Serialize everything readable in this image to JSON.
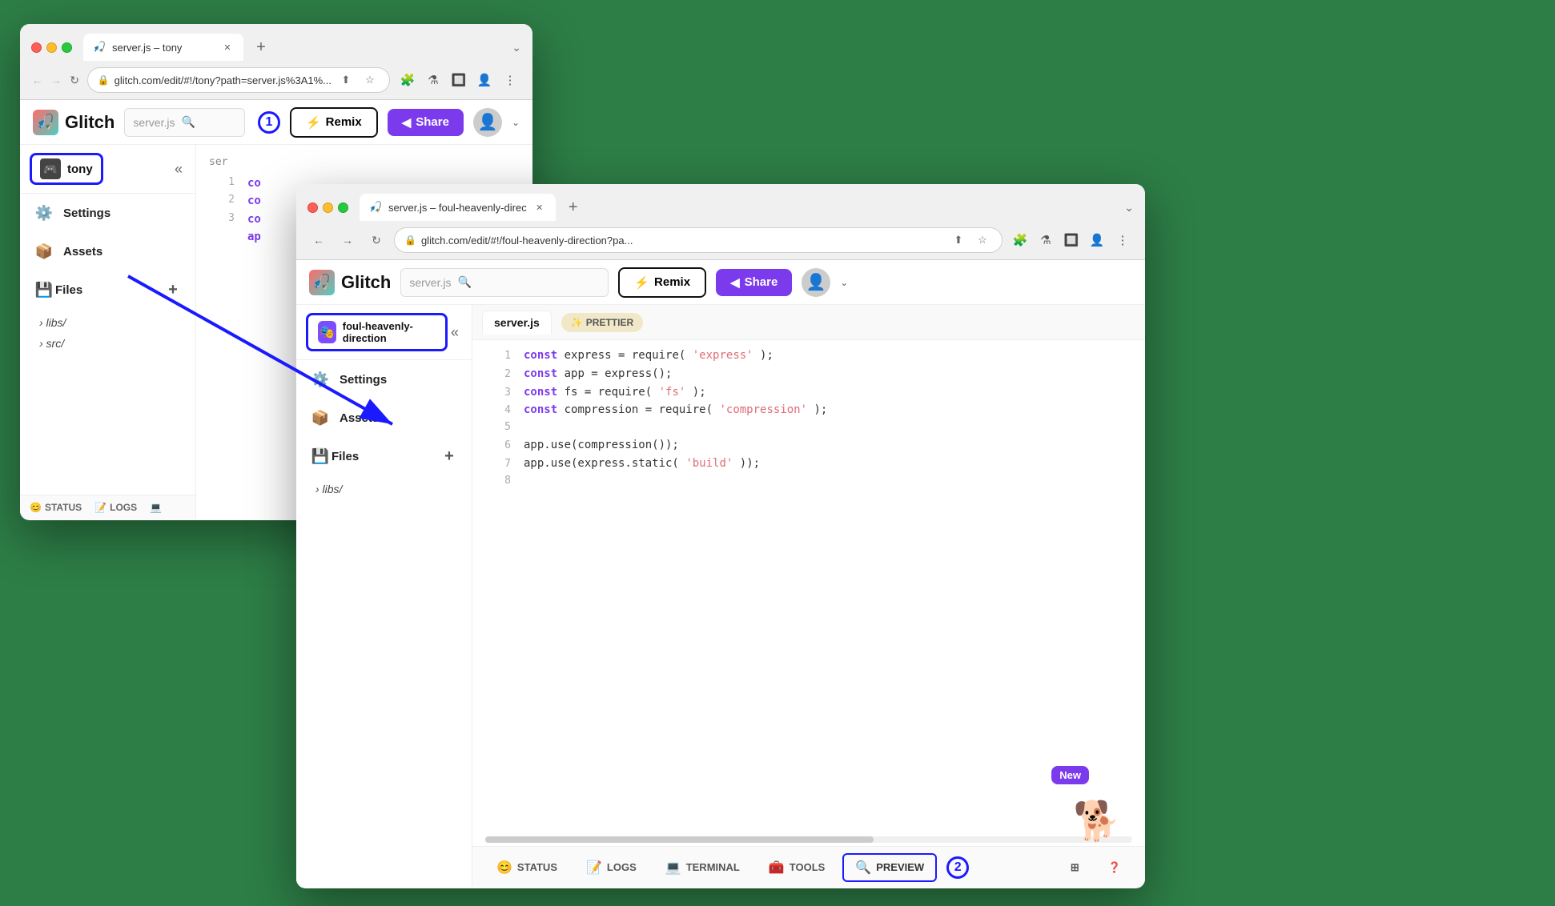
{
  "window1": {
    "tab_title": "server.js – tony",
    "tab_favicon": "🎣",
    "address": "glitch.com/edit/#!/tony?path=server.js%3A1%...",
    "glitch_logo": "Glitch",
    "search_placeholder": "server.js",
    "btn_remix_label": "Remix",
    "btn_share_label": "Share",
    "project_name": "tony",
    "sidebar_items": [
      {
        "label": "Settings",
        "icon": "⚙️"
      },
      {
        "label": "Assets",
        "icon": "📦"
      },
      {
        "label": "Files",
        "icon": "💾"
      }
    ],
    "file_tree": [
      {
        "label": "libs/",
        "type": "folder"
      },
      {
        "label": "src/",
        "type": "folder"
      }
    ],
    "status_items": [
      {
        "label": "STATUS",
        "icon": "😊"
      },
      {
        "label": "LOGS",
        "icon": "📝"
      }
    ],
    "code_lines": [
      {
        "num": "1",
        "content": "co"
      },
      {
        "num": "2",
        "content": "co"
      },
      {
        "num": "3",
        "content": "co"
      }
    ]
  },
  "window2": {
    "tab_title": "server.js – foul-heavenly-direc",
    "tab_favicon": "🎣",
    "address": "glitch.com/edit/#!/foul-heavenly-direction?pa...",
    "glitch_logo": "Glitch",
    "search_placeholder": "server.js",
    "btn_remix_label": "Remix",
    "btn_share_label": "Share",
    "project_name": "foul-heavenly-direction",
    "project_avatar": "🎭",
    "sidebar_items": [
      {
        "label": "Settings",
        "icon": "⚙️"
      },
      {
        "label": "Assets",
        "icon": "📦"
      },
      {
        "label": "Files",
        "icon": "💾"
      }
    ],
    "file_tree": [
      {
        "label": "libs/",
        "type": "folder"
      }
    ],
    "status_items": [
      {
        "label": "STATUS",
        "icon": "😊"
      },
      {
        "label": "LOGS",
        "icon": "📝"
      },
      {
        "label": "TERMINAL",
        "icon": "💻"
      },
      {
        "label": "TOOLS",
        "icon": "🧰"
      },
      {
        "label": "PREVIEW",
        "icon": "🔍"
      }
    ],
    "editor_tab": "server.js",
    "prettier_label": "PRETTIER",
    "code_lines": [
      {
        "num": "1",
        "kw": "const",
        "rest": " express = require(",
        "str": "'express'",
        "end": ");"
      },
      {
        "num": "2",
        "kw": "const",
        "rest": " app = express();"
      },
      {
        "num": "3",
        "kw": "const",
        "rest": " fs = require(",
        "str": "'fs'",
        "end": ");"
      },
      {
        "num": "4",
        "kw": "const",
        "rest": " compression = require(",
        "str": "'compression'",
        "end": ");"
      },
      {
        "num": "5",
        "content": ""
      },
      {
        "num": "6",
        "content": "app.use(compression());"
      },
      {
        "num": "7",
        "content": "app.use(express.static(",
        "str": "'build'",
        "end": "));"
      },
      {
        "num": "8",
        "content": ""
      }
    ],
    "new_badge_label": "New",
    "step_number_1": "1",
    "step_number_2": "2"
  }
}
